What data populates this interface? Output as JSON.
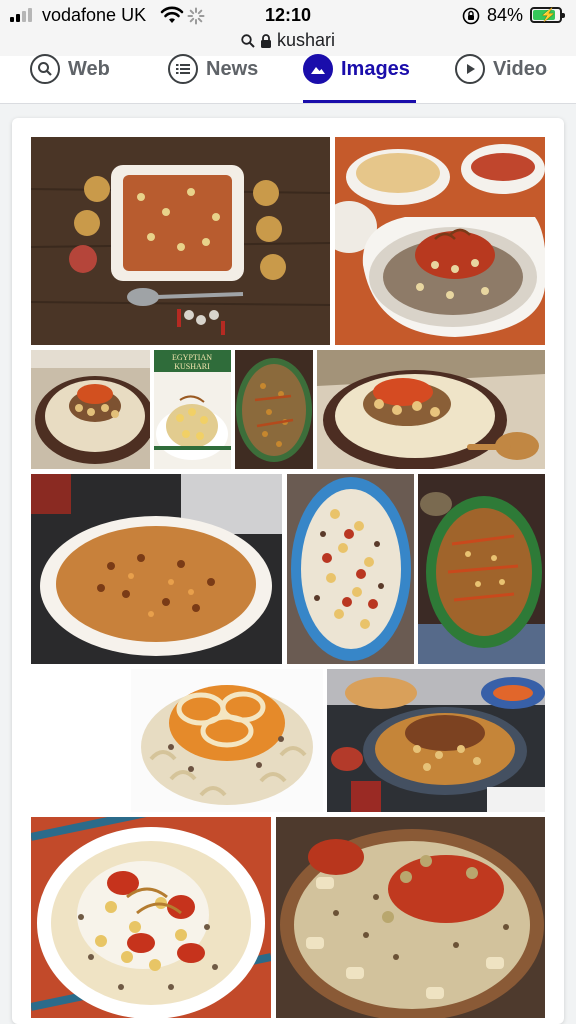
{
  "status_bar": {
    "carrier": "vodafone UK",
    "time": "12:10",
    "battery": "84%",
    "battery_level": 0.84
  },
  "address_bar": {
    "query": "kushari"
  },
  "tabs": [
    {
      "label": "Web",
      "icon": "search-icon",
      "active": false
    },
    {
      "label": "News",
      "icon": "news-icon",
      "active": false
    },
    {
      "label": "Images",
      "icon": "image-icon",
      "active": true
    },
    {
      "label": "Video",
      "icon": "play-icon",
      "active": false
    }
  ],
  "colors": {
    "accent": "#1a0dab",
    "battery": "#35c759"
  },
  "results": {
    "thumb_2_caption_1": "EGYPTIAN",
    "thumb_2_caption_2": "KUSHARI"
  }
}
